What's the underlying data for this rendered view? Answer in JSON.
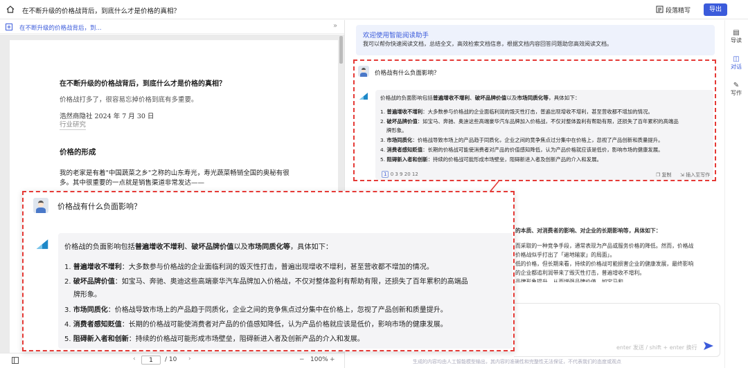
{
  "topbar": {
    "title": "在不断升级的价格战背后，到底什么才是价格的真相？",
    "paragraph_rewrite": "段落精写",
    "export": "导出"
  },
  "subbar": {
    "title": "在不断升级的价格战背后，到..."
  },
  "document": {
    "heading": "在不断升级的价格战背后，到底什么才是价格的真相？",
    "lead": "价格战打多了，很容易忘掉价格到底有多重要。",
    "byline": "浩然商隐社 2024 年 7 月 30 日",
    "tag": "行业研究",
    "section": "价格的形成",
    "para1": "我的老家是有着\"中国蔬菜之乡\"之称的山东寿光，寿光蔬菜畅销全国的奥秘有很",
    "para2": "多。其中很重要的一点就是销售渠道非常发达——"
  },
  "pager": {
    "current": "1",
    "total": "/ 10",
    "zoom": "100%",
    "minus": "−",
    "plus": "+"
  },
  "assistant": {
    "welcome_title": "欢迎使用智能阅读助手",
    "welcome_desc": "我可以帮你快速阅读文档，总结全文，高效检索文档信息，根据文档内容回答问题助您高效阅读文档。",
    "question": "价格战有什么负面影响？",
    "answer": {
      "intro_pre": "价格战的负面影响包括",
      "intro_b1": "普遍增收不增利",
      "intro_sep": "、",
      "intro_b2": "破坏品牌价值",
      "intro_mid": "以及",
      "intro_b3": "市场同质化等",
      "intro_post": "，具体如下：",
      "items": [
        {
          "num": "1.",
          "title": "普遍增收不增利",
          "text": "：大多数参与价格战的企业面临利润的毁灭性打击，普遍出现增收不增利，甚至营收都不增加的情况。"
        },
        {
          "num": "2.",
          "title": "破坏品牌价值",
          "text": "：如宝马、奔驰、奥迪这些高端豪华汽车品牌加入价格战，不仅对整体盈利有帮助有限，还损失了百年累积的高端品",
          "cont": "牌形象。"
        },
        {
          "num": "3.",
          "title": "市场同质化",
          "text": "：价格战导致市场上的产品趋于同质化，企业之间的竞争焦点过分集中在价格上，忽视了产品创新和质量提升。"
        },
        {
          "num": "4.",
          "title": "消费者感知贬值",
          "text": "：长期的价格战可能使消费者对产品的价值感知降低，认为产品价格就应该是低价，影响市场的健康发展。"
        },
        {
          "num": "5.",
          "title": "阻碍新入者和创新",
          "text": "：持续的价格战可能形成市场壁垒，阻碍新进入者及创新产品的介入和发展。"
        }
      ],
      "refs": "0 3 9 20 12",
      "copy": "复制",
      "insert": "插入至写作"
    },
    "bg_answer": {
      "line1": "的本质、对消费者的影响、对企业的长期影响等，具体如下：",
      "line2": "而采取的一种竞争手段，通常表现为产品或服务价格的降低。然而，价格战",
      "line3": "价格战似乎打出了「遍地输家」的局面」。",
      "line4": "低的价格，但长期来看，持续的价格战可能损害企业的健康发展，最终影响",
      "line5": "的企业都追利润带来了毁灭性打击，普遍增收不增利。",
      "line6": "品牌形象提升，从而增强品牌价值，如宝马和..."
    },
    "input_hint": "enter 发送 / shift + enter 换行",
    "footer": "生成的内容均由人工智能模型输出，其内容的准确性和完整性无法保证，不代表我们的态度或观点"
  },
  "sidebar": {
    "items": [
      {
        "label": "导读"
      },
      {
        "label": "对话"
      },
      {
        "label": "写作"
      }
    ]
  },
  "colors": {
    "accent": "#3b5bdb",
    "highlight": "#e53935"
  }
}
